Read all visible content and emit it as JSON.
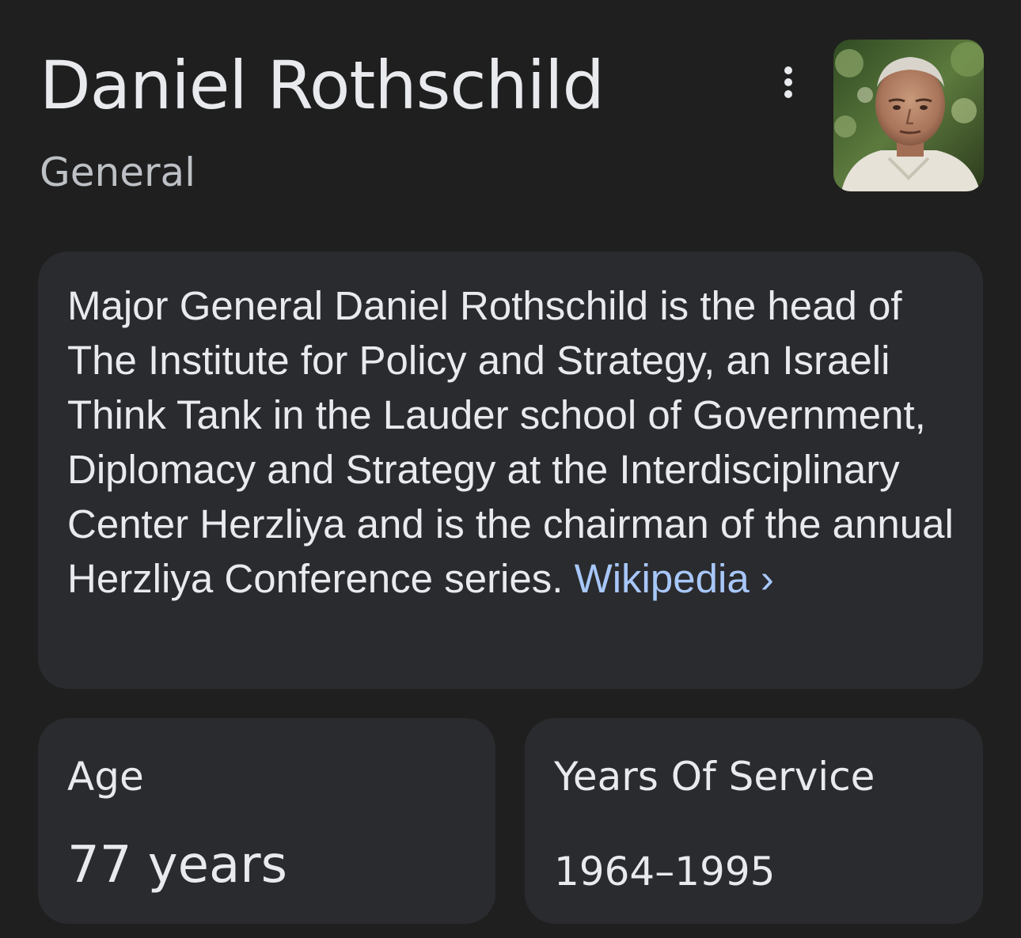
{
  "header": {
    "title": "Daniel Rothschild",
    "subtitle": "General",
    "more_icon": "more-vert-icon",
    "photo_alt": "Daniel Rothschild"
  },
  "description": {
    "text": "Major General Daniel Rothschild is the head of The Institute for Policy and Strategy, an Israeli Think Tank in the Lauder school of Government, Diplomacy and Strategy at the Interdisciplinary Center Herzliya and is the chairman of the annual Herzliya Conference series.",
    "source_label": "Wikipedia",
    "source_chevron": "›"
  },
  "facts": {
    "age": {
      "label": "Age",
      "value": "77 years"
    },
    "years_of_service": {
      "label": "Years Of Service",
      "value": "1964–1995"
    }
  },
  "colors": {
    "background": "#1f1f1f",
    "card": "#2a2b2e",
    "text": "#e8eaed",
    "secondary_text": "#bdc1c6",
    "link": "#a8c7fa"
  }
}
